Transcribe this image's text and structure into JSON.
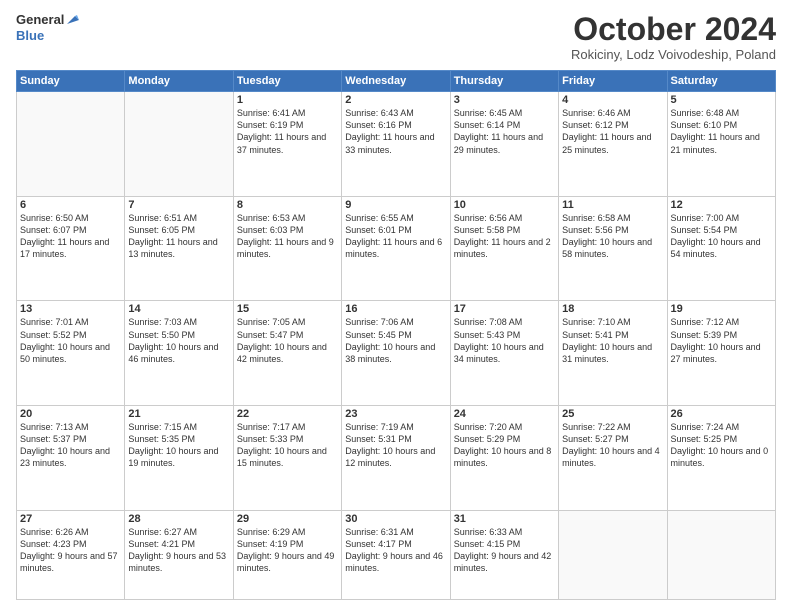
{
  "header": {
    "logo_general": "General",
    "logo_blue": "Blue",
    "month_title": "October 2024",
    "location": "Rokiciny, Lodz Voivodeship, Poland"
  },
  "weekdays": [
    "Sunday",
    "Monday",
    "Tuesday",
    "Wednesday",
    "Thursday",
    "Friday",
    "Saturday"
  ],
  "weeks": [
    [
      {
        "day": "",
        "info": ""
      },
      {
        "day": "",
        "info": ""
      },
      {
        "day": "1",
        "info": "Sunrise: 6:41 AM\nSunset: 6:19 PM\nDaylight: 11 hours and 37 minutes."
      },
      {
        "day": "2",
        "info": "Sunrise: 6:43 AM\nSunset: 6:16 PM\nDaylight: 11 hours and 33 minutes."
      },
      {
        "day": "3",
        "info": "Sunrise: 6:45 AM\nSunset: 6:14 PM\nDaylight: 11 hours and 29 minutes."
      },
      {
        "day": "4",
        "info": "Sunrise: 6:46 AM\nSunset: 6:12 PM\nDaylight: 11 hours and 25 minutes."
      },
      {
        "day": "5",
        "info": "Sunrise: 6:48 AM\nSunset: 6:10 PM\nDaylight: 11 hours and 21 minutes."
      }
    ],
    [
      {
        "day": "6",
        "info": "Sunrise: 6:50 AM\nSunset: 6:07 PM\nDaylight: 11 hours and 17 minutes."
      },
      {
        "day": "7",
        "info": "Sunrise: 6:51 AM\nSunset: 6:05 PM\nDaylight: 11 hours and 13 minutes."
      },
      {
        "day": "8",
        "info": "Sunrise: 6:53 AM\nSunset: 6:03 PM\nDaylight: 11 hours and 9 minutes."
      },
      {
        "day": "9",
        "info": "Sunrise: 6:55 AM\nSunset: 6:01 PM\nDaylight: 11 hours and 6 minutes."
      },
      {
        "day": "10",
        "info": "Sunrise: 6:56 AM\nSunset: 5:58 PM\nDaylight: 11 hours and 2 minutes."
      },
      {
        "day": "11",
        "info": "Sunrise: 6:58 AM\nSunset: 5:56 PM\nDaylight: 10 hours and 58 minutes."
      },
      {
        "day": "12",
        "info": "Sunrise: 7:00 AM\nSunset: 5:54 PM\nDaylight: 10 hours and 54 minutes."
      }
    ],
    [
      {
        "day": "13",
        "info": "Sunrise: 7:01 AM\nSunset: 5:52 PM\nDaylight: 10 hours and 50 minutes."
      },
      {
        "day": "14",
        "info": "Sunrise: 7:03 AM\nSunset: 5:50 PM\nDaylight: 10 hours and 46 minutes."
      },
      {
        "day": "15",
        "info": "Sunrise: 7:05 AM\nSunset: 5:47 PM\nDaylight: 10 hours and 42 minutes."
      },
      {
        "day": "16",
        "info": "Sunrise: 7:06 AM\nSunset: 5:45 PM\nDaylight: 10 hours and 38 minutes."
      },
      {
        "day": "17",
        "info": "Sunrise: 7:08 AM\nSunset: 5:43 PM\nDaylight: 10 hours and 34 minutes."
      },
      {
        "day": "18",
        "info": "Sunrise: 7:10 AM\nSunset: 5:41 PM\nDaylight: 10 hours and 31 minutes."
      },
      {
        "day": "19",
        "info": "Sunrise: 7:12 AM\nSunset: 5:39 PM\nDaylight: 10 hours and 27 minutes."
      }
    ],
    [
      {
        "day": "20",
        "info": "Sunrise: 7:13 AM\nSunset: 5:37 PM\nDaylight: 10 hours and 23 minutes."
      },
      {
        "day": "21",
        "info": "Sunrise: 7:15 AM\nSunset: 5:35 PM\nDaylight: 10 hours and 19 minutes."
      },
      {
        "day": "22",
        "info": "Sunrise: 7:17 AM\nSunset: 5:33 PM\nDaylight: 10 hours and 15 minutes."
      },
      {
        "day": "23",
        "info": "Sunrise: 7:19 AM\nSunset: 5:31 PM\nDaylight: 10 hours and 12 minutes."
      },
      {
        "day": "24",
        "info": "Sunrise: 7:20 AM\nSunset: 5:29 PM\nDaylight: 10 hours and 8 minutes."
      },
      {
        "day": "25",
        "info": "Sunrise: 7:22 AM\nSunset: 5:27 PM\nDaylight: 10 hours and 4 minutes."
      },
      {
        "day": "26",
        "info": "Sunrise: 7:24 AM\nSunset: 5:25 PM\nDaylight: 10 hours and 0 minutes."
      }
    ],
    [
      {
        "day": "27",
        "info": "Sunrise: 6:26 AM\nSunset: 4:23 PM\nDaylight: 9 hours and 57 minutes."
      },
      {
        "day": "28",
        "info": "Sunrise: 6:27 AM\nSunset: 4:21 PM\nDaylight: 9 hours and 53 minutes."
      },
      {
        "day": "29",
        "info": "Sunrise: 6:29 AM\nSunset: 4:19 PM\nDaylight: 9 hours and 49 minutes."
      },
      {
        "day": "30",
        "info": "Sunrise: 6:31 AM\nSunset: 4:17 PM\nDaylight: 9 hours and 46 minutes."
      },
      {
        "day": "31",
        "info": "Sunrise: 6:33 AM\nSunset: 4:15 PM\nDaylight: 9 hours and 42 minutes."
      },
      {
        "day": "",
        "info": ""
      },
      {
        "day": "",
        "info": ""
      }
    ]
  ]
}
